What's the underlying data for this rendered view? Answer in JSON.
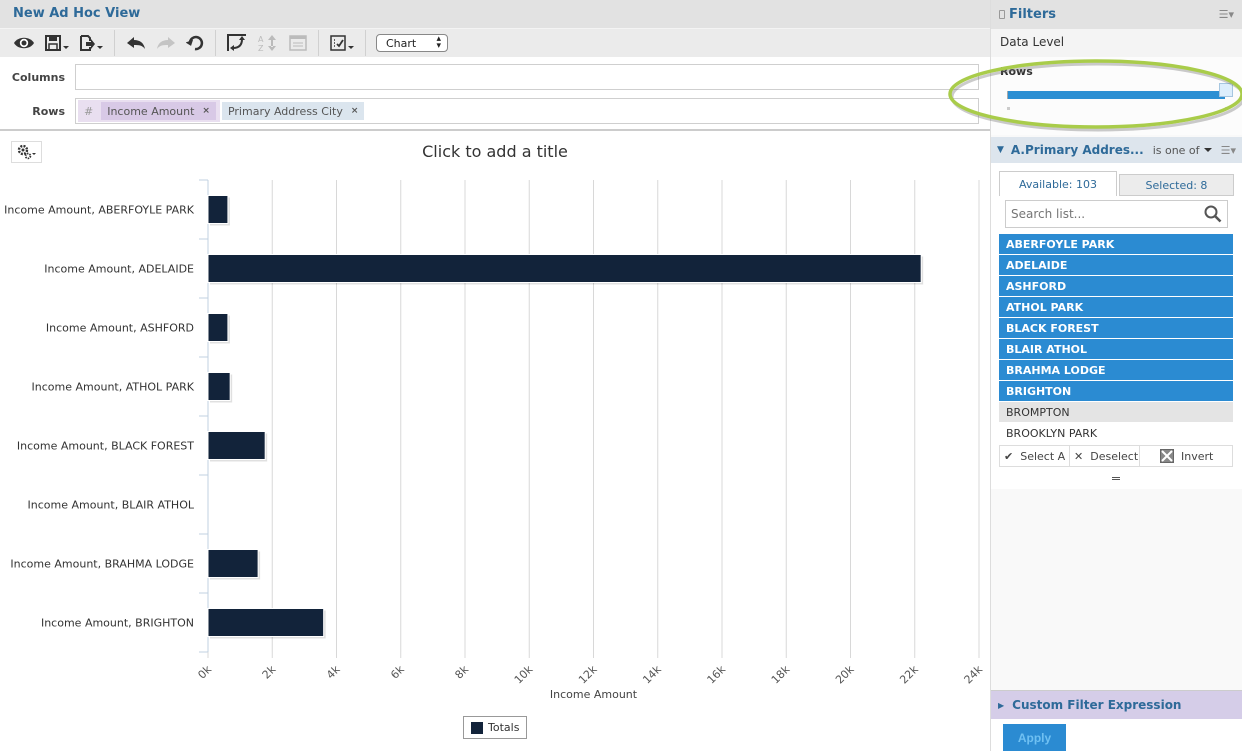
{
  "window": {
    "title": "New Ad Hoc View"
  },
  "toolbar": {
    "icons": [
      "eye-icon",
      "save-icon",
      "export-icon",
      "undo-icon",
      "redo-icon",
      "reset-icon",
      "pivot-icon",
      "sort-icon",
      "page-icon",
      "options-icon"
    ],
    "view_type": "Chart"
  },
  "fields": {
    "columns_label": "Columns",
    "rows_label": "Rows",
    "hash": "#",
    "rows": [
      {
        "label": "Income Amount",
        "kind": "measure"
      },
      {
        "label": "Primary Address City",
        "kind": "dimension"
      }
    ],
    "remove_glyph": "×"
  },
  "chart_title": "Click to add a title",
  "chart_data": {
    "type": "bar",
    "orientation": "horizontal",
    "title": "Click to add a title",
    "categories": [
      "Income Amount, ABERFOYLE PARK",
      "Income Amount, ADELAIDE",
      "Income Amount, ASHFORD",
      "Income Amount, ATHOL PARK",
      "Income Amount, BLACK FOREST",
      "Income Amount, BLAIR ATHOL",
      "Income Amount, BRAHMA LODGE",
      "Income Amount, BRIGHTON"
    ],
    "series": [
      {
        "name": "Totals",
        "color": "#12233a",
        "values": [
          620,
          22200,
          620,
          690,
          1780,
          0,
          1560,
          3600
        ]
      }
    ],
    "xlabel": "Income Amount",
    "ylabel": "",
    "xlim": [
      0,
      24000
    ],
    "xticks": [
      0,
      2000,
      4000,
      6000,
      8000,
      10000,
      12000,
      14000,
      16000,
      18000,
      20000,
      22000,
      24000
    ],
    "xtick_labels": [
      "0k",
      "2k",
      "4k",
      "6k",
      "8k",
      "10k",
      "12k",
      "14k",
      "16k",
      "18k",
      "20k",
      "22k",
      "24k"
    ],
    "grid": true,
    "legend": {
      "position": "bottom-center",
      "entries": [
        "Totals"
      ]
    }
  },
  "filters": {
    "title": "Filters",
    "data_level": "Data Level",
    "rows_label": "Rows",
    "rows_slider_fraction": 1.0,
    "filter": {
      "name": "A.Primary Addres...",
      "operator": "is one of",
      "available_tab": "Available: 103",
      "selected_tab": "Selected: 8",
      "search_placeholder": "Search list...",
      "items": [
        {
          "label": "ABERFOYLE PARK",
          "state": "selected"
        },
        {
          "label": "ADELAIDE",
          "state": "selected"
        },
        {
          "label": "ASHFORD",
          "state": "selected"
        },
        {
          "label": "ATHOL PARK",
          "state": "selected"
        },
        {
          "label": "BLACK FOREST",
          "state": "selected"
        },
        {
          "label": "BLAIR ATHOL",
          "state": "selected"
        },
        {
          "label": "BRAHMA LODGE",
          "state": "selected"
        },
        {
          "label": "BRIGHTON",
          "state": "selected"
        },
        {
          "label": "BROMPTON",
          "state": "hover"
        },
        {
          "label": "BROOKLYN PARK",
          "state": "plain"
        }
      ],
      "actions": {
        "select_all": "Select A",
        "deselect": "Deselect",
        "invert": "Invert"
      }
    },
    "custom_expression": "Custom Filter Expression",
    "apply": "Apply"
  },
  "colors": {
    "accent": "#2e6a99",
    "selection": "#2b8bd2",
    "bar": "#12233a",
    "highlight_ring": "#a9cc4a"
  }
}
